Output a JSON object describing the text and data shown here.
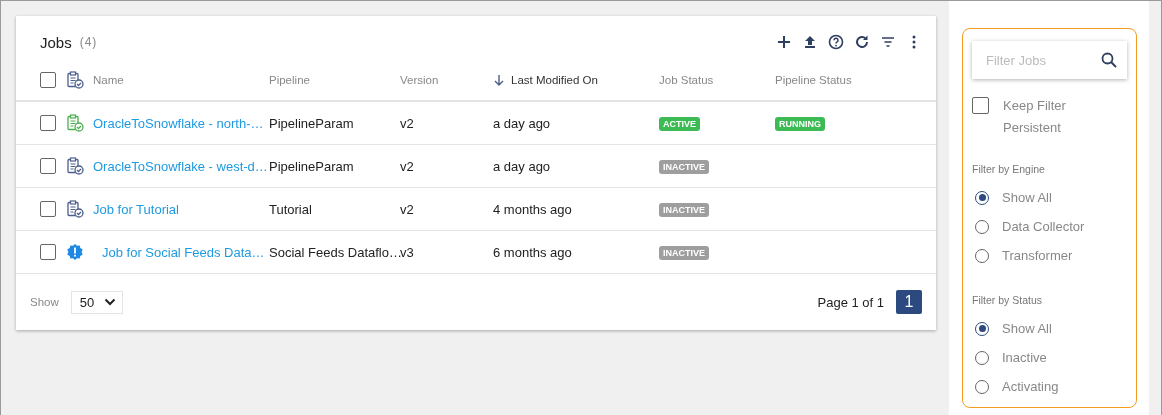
{
  "jobs": {
    "title": "Jobs",
    "count": "(4)",
    "toolbar": [
      {
        "kind": "add"
      },
      {
        "kind": "upload"
      },
      {
        "kind": "help"
      },
      {
        "kind": "refresh"
      },
      {
        "kind": "filter"
      },
      {
        "kind": "more"
      }
    ],
    "select_all": {
      "checked": false
    },
    "columns": [
      {
        "label": "Name",
        "sorted": false
      },
      {
        "label": "Pipeline",
        "sorted": false
      },
      {
        "label": "Version",
        "sorted": false
      },
      {
        "label": "Last Modified On",
        "sorted": true
      },
      {
        "label": "Job Status",
        "sorted": false
      },
      {
        "label": "Pipeline Status",
        "sorted": false
      }
    ],
    "rows": [
      {
        "checked": false,
        "kind": "running",
        "name": "OracleToSnowflake - north-…",
        "pipeline": "PipelineParam",
        "version": "v2",
        "modified": "a day ago",
        "job_status": {
          "text": "ACTIVE",
          "color": "#3cba54"
        },
        "pipeline_status": {
          "text": "RUNNING",
          "color": "#3cba54"
        }
      },
      {
        "checked": false,
        "kind": "idle",
        "name": "OracleToSnowflake - west-d…",
        "pipeline": "PipelineParam",
        "version": "v2",
        "modified": "a day ago",
        "job_status": {
          "text": "INACTIVE",
          "color": "#9e9e9e"
        }
      },
      {
        "checked": false,
        "kind": "idle",
        "name": "Job for Tutorial",
        "pipeline": "Tutorial",
        "version": "v2",
        "modified": "4 months ago",
        "job_status": {
          "text": "INACTIVE",
          "color": "#9e9e9e"
        }
      },
      {
        "checked": false,
        "kind": "alert",
        "name": "Job for Social Feeds Data…",
        "pipeline": "Social Feeds Dataflo…",
        "version": "v3",
        "modified": "6 months ago",
        "job_status": {
          "text": "INACTIVE",
          "color": "#9e9e9e"
        }
      }
    ],
    "footer": {
      "show_label": "Show",
      "page_size": "50",
      "page_info": "Page 1 of 1",
      "pages": [
        {
          "label": "1",
          "selected": true
        }
      ]
    }
  },
  "filters": {
    "search": {
      "placeholder": "Filter Jobs"
    },
    "keep_filter": {
      "label": "Keep Filter Persistent",
      "checked": false
    },
    "groups": [
      {
        "title": "Filter by Engine",
        "options": [
          {
            "label": "Show All",
            "selected": true
          },
          {
            "label": "Data Collector",
            "selected": false
          },
          {
            "label": "Transformer",
            "selected": false
          }
        ]
      },
      {
        "title": "Filter by Status",
        "options": [
          {
            "label": "Show All",
            "selected": true
          },
          {
            "label": "Inactive",
            "selected": false
          },
          {
            "label": "Activating",
            "selected": false
          }
        ]
      }
    ]
  }
}
